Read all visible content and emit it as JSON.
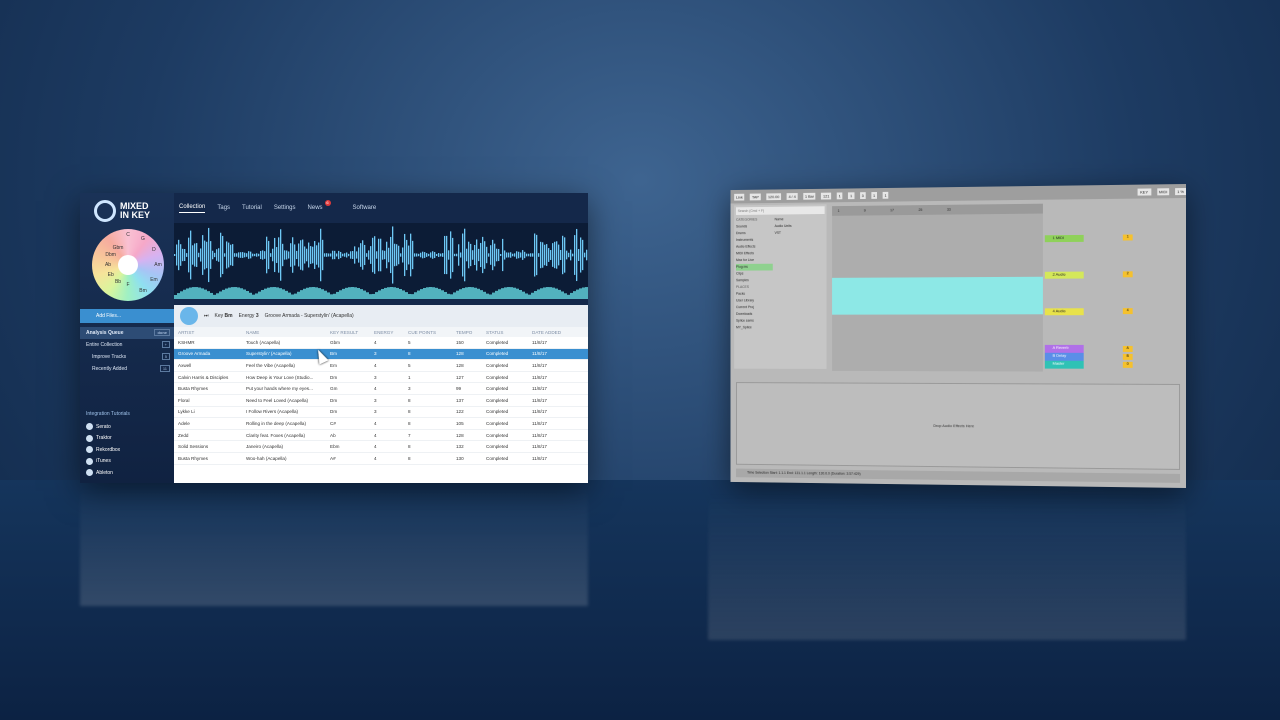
{
  "mik": {
    "logo": {
      "line1": "MIXED",
      "line2": "IN KEY"
    },
    "wheel_keys": [
      "C",
      "G",
      "D",
      "Am",
      "Em",
      "Bm",
      "F",
      "Bb",
      "Eb",
      "Ab",
      "Dbm",
      "Gbm"
    ],
    "nav": [
      {
        "label": "Collection",
        "active": true
      },
      {
        "label": "Tags"
      },
      {
        "label": "Tutorial"
      },
      {
        "label": "Settings"
      },
      {
        "label": "News",
        "badge": "6"
      },
      {
        "label": "Software"
      }
    ],
    "add_files": "Add Files...",
    "sidebar": [
      {
        "label": "Analysis Queue",
        "count": "done",
        "style": "sel"
      },
      {
        "label": "Entire Collection",
        "count": "+"
      },
      {
        "label": "Improve Tracks",
        "count": "5",
        "style": "sub"
      },
      {
        "label": "Recently Added",
        "count": "11",
        "style": "sub"
      }
    ],
    "integrations_title": "Integration Tutorials",
    "integrations": [
      "Serato",
      "Traktor",
      "Rekordbox",
      "iTunes",
      "Ableton"
    ],
    "player": {
      "key_label": "Key",
      "key": "Bm",
      "energy_label": "Energy",
      "energy": "3",
      "now_playing": "Groove Armada - Superstylin' (Acapella)"
    },
    "columns": [
      "ARTIST",
      "NAME",
      "KEY RESULT",
      "ENERGY",
      "CUE POINTS",
      "TEMPO",
      "STATUS",
      "DATE ADDED"
    ],
    "rows": [
      [
        "KSHMR",
        "Touch (Acapella)",
        "Gbm",
        "4",
        "5",
        "150",
        "Completed",
        "11/8/17"
      ],
      [
        "Groove Armada",
        "Superstylin' (Acapella)",
        "Bm",
        "3",
        "8",
        "128",
        "Completed",
        "11/8/17"
      ],
      [
        "Axwell",
        "Feel the Vibe (Acapella)",
        "Em",
        "4",
        "5",
        "128",
        "Completed",
        "11/8/17"
      ],
      [
        "Calvin Harris & Disciples",
        "How Deep is Your Love (Studio...",
        "Dm",
        "3",
        "1",
        "127",
        "Completed",
        "11/8/17"
      ],
      [
        "Busta Rhymes",
        "Put your hands where my eyes...",
        "Gm",
        "4",
        "3",
        "99",
        "Completed",
        "11/8/17"
      ],
      [
        "Floral",
        "Need to Feel Loved (Acapella)",
        "Dm",
        "3",
        "8",
        "137",
        "Completed",
        "11/8/17"
      ],
      [
        "Lykke Li",
        "I Follow Rivers (Acapella)",
        "Dm",
        "3",
        "8",
        "122",
        "Completed",
        "11/8/17"
      ],
      [
        "Adele",
        "Rolling in the deep (Acapella)",
        "C#",
        "4",
        "8",
        "105",
        "Completed",
        "11/8/17"
      ],
      [
        "Zedd",
        "Clarity feat. Foxes (Acapella)",
        "Ab",
        "4",
        "7",
        "128",
        "Completed",
        "11/8/17"
      ],
      [
        "Solid Sessions",
        "Janeiro (Acapella)",
        "Ebm",
        "4",
        "8",
        "132",
        "Completed",
        "11/8/17"
      ],
      [
        "Busta Rhymes",
        "Woo-hah (Acapella)",
        "A#",
        "4",
        "8",
        "130",
        "Completed",
        "11/8/17"
      ]
    ],
    "selected_row": 1
  },
  "ableton": {
    "toolbar": [
      "Link",
      "TAP",
      "120.00",
      "4 / 4",
      "1 Bar",
      "121",
      "1",
      "1",
      "3",
      "1",
      "1",
      "KEY",
      "MIDI",
      "1 %"
    ],
    "search_placeholder": "Search (Cmd + F)",
    "categories_title": "CATEGORIES",
    "categories": [
      "Sounds",
      "Drums",
      "Instruments",
      "Audio Effects",
      "MIDI Effects",
      "Max for Live",
      "Plug-ins",
      "Clips",
      "Samples"
    ],
    "selected_category": "Plug-ins",
    "places_title": "PLACES",
    "places": [
      "Packs",
      "User Library",
      "Current Proj",
      "Downloads",
      "Splice sams",
      "MY_Splice"
    ],
    "names_title": "Name",
    "names": [
      "Audio Units",
      "VST"
    ],
    "ruler": [
      "1",
      "9",
      "17",
      "25",
      "33"
    ],
    "tracks": [
      {
        "name": "1 MIDI",
        "color": "#8fd15a",
        "vol": "1"
      },
      {
        "name": "2 Audio",
        "color": "#d4e85a",
        "vol": "2"
      },
      {
        "name": "4 Audio",
        "color": "#e8e24a",
        "vol": "4"
      }
    ],
    "returns": [
      {
        "name": "A Reverb",
        "color": "#b070e8",
        "vol": "A"
      },
      {
        "name": "B Delay",
        "color": "#5a8ee8",
        "vol": "B"
      },
      {
        "name": "Master",
        "color": "#2fc2b5",
        "vol": "0"
      }
    ],
    "device_hint": "Drop Audio Effects Here",
    "status": "Time Selection   Start: 1.1.1   End: 131.1.1   Length: 130.0.0   (Duration: 3:57:429)",
    "track_label": "2-Audio"
  }
}
